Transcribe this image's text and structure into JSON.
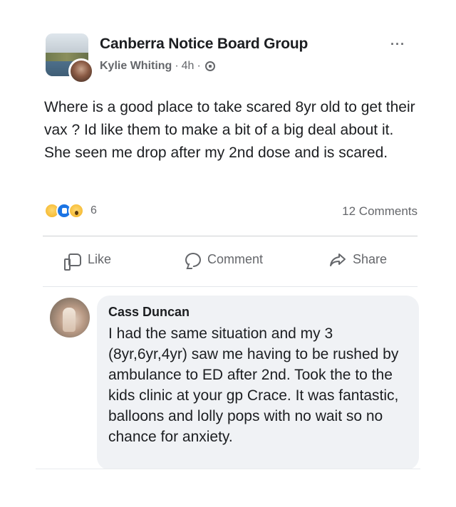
{
  "header": {
    "group_name": "Canberra Notice Board Group",
    "author": "Kylie Whiting",
    "separator": "·",
    "time": "4h",
    "separator2": "·",
    "more_label": "···"
  },
  "post": {
    "text": "Where is a good place to take scared 8yr old to get their vax ? Id like them to make a bit of a big deal about it. She seen me drop after my 2nd dose and is scared."
  },
  "stats": {
    "reaction_count": "6",
    "comments_label": "12 Comments"
  },
  "actions": {
    "like": "Like",
    "comment": "Comment",
    "share": "Share"
  },
  "comment": {
    "name": "Cass Duncan",
    "text": "I had the same situation and my 3 (8yr,6yr,4yr) saw me having to be rushed by ambulance to ED after 2nd. Took the to the kids clinic at your gp Crace. It was fantastic, balloons and lolly pops with no wait so no chance for anxiety."
  },
  "colors": {
    "text": "#1c1e21",
    "secondary": "#65676b",
    "like_blue": "#1b74e4",
    "comment_bg": "#f0f2f5"
  },
  "icons": [
    "globe-icon",
    "more-icon",
    "like-icon",
    "comment-icon",
    "share-icon",
    "sad-reaction-icon",
    "like-reaction-icon",
    "wow-reaction-icon"
  ]
}
